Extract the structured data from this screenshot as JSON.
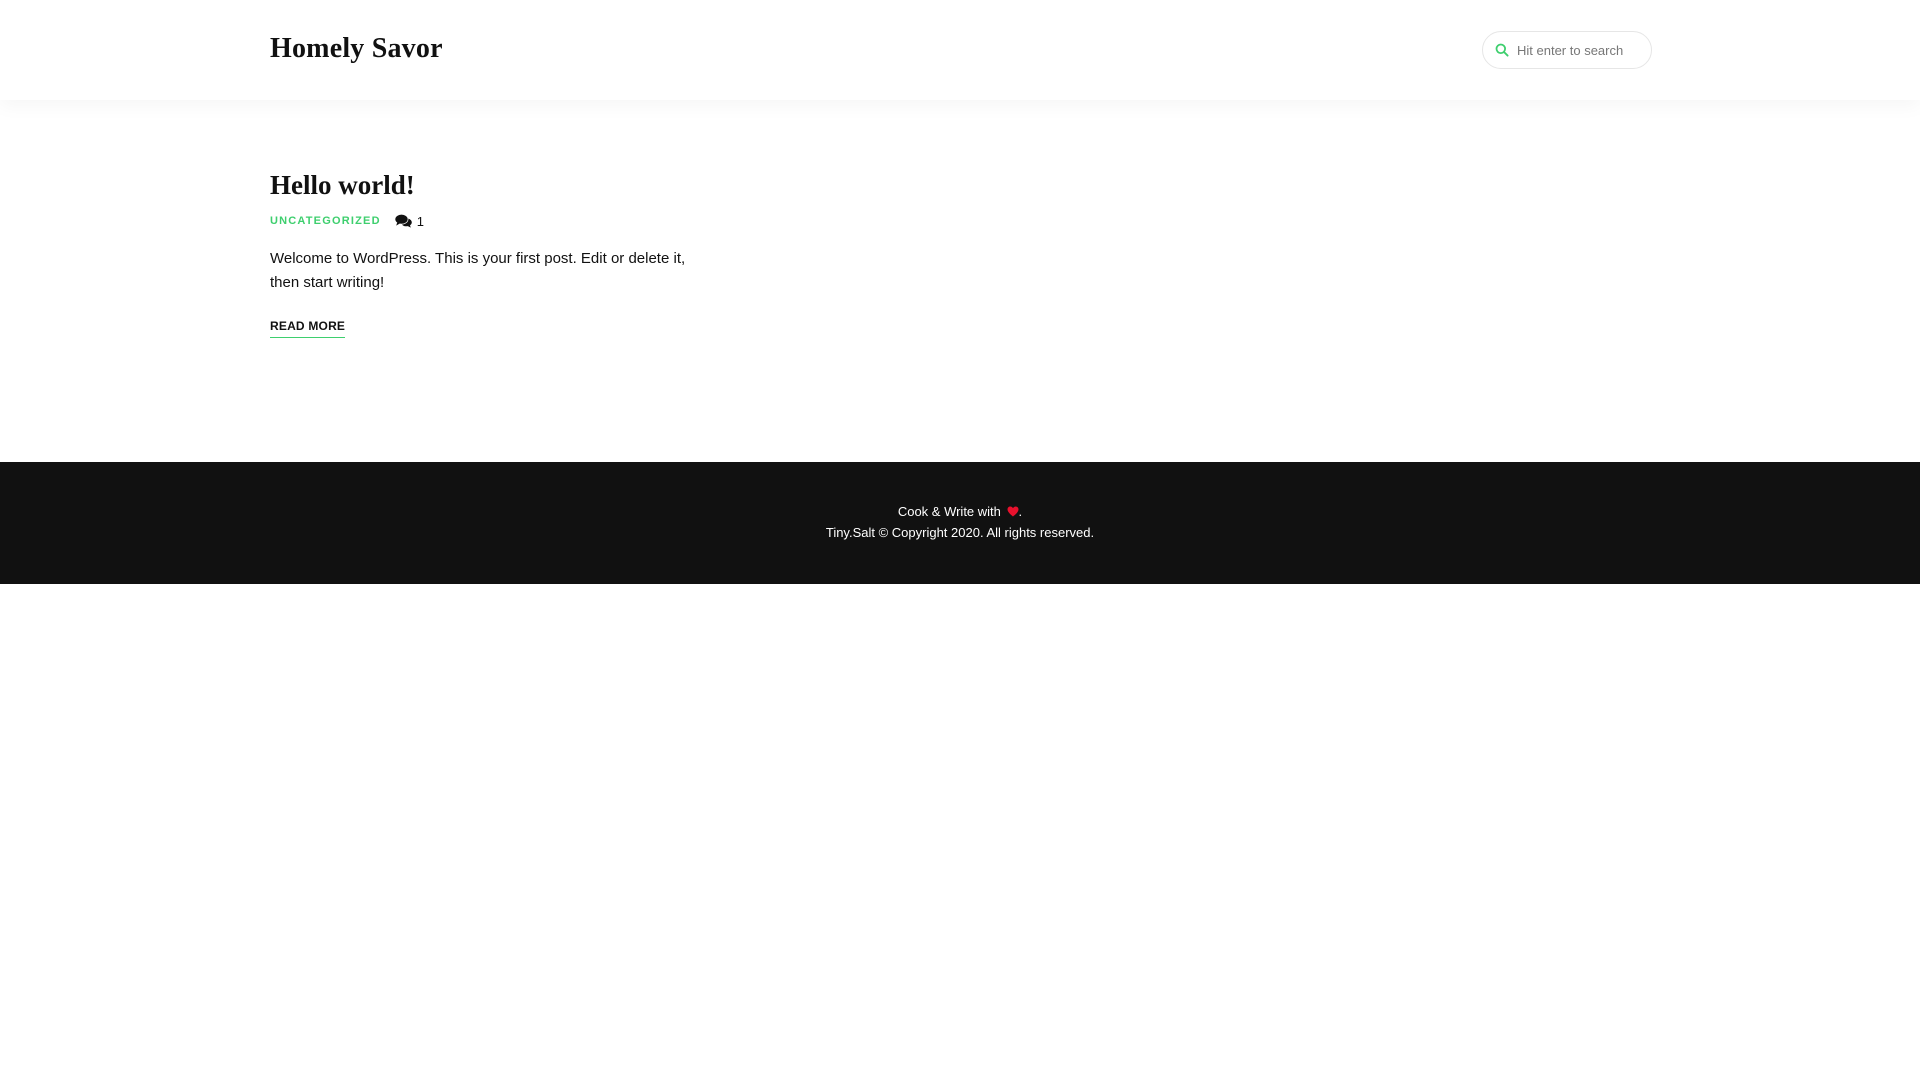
{
  "header": {
    "site_title": "Homely Savor",
    "search": {
      "placeholder": "Hit enter to search",
      "icon": "search-icon"
    }
  },
  "post": {
    "title": "Hello world!",
    "category": "UNCATEGORIZED",
    "comments_icon": "comments-icon",
    "comment_count": "1",
    "excerpt": "Welcome to WordPress. This is your first post. Edit or delete it, then start writing!",
    "read_more": "READ MORE"
  },
  "footer": {
    "line1_prefix": "Cook & Write with",
    "heart_icon": "heart-icon",
    "line1_suffix": ".",
    "line2": "Tiny.Salt © Copyright 2020. All rights reserved."
  },
  "colors": {
    "accent": "#3ecf6e",
    "heart": "#e8112d",
    "footer_bg": "#111111"
  }
}
